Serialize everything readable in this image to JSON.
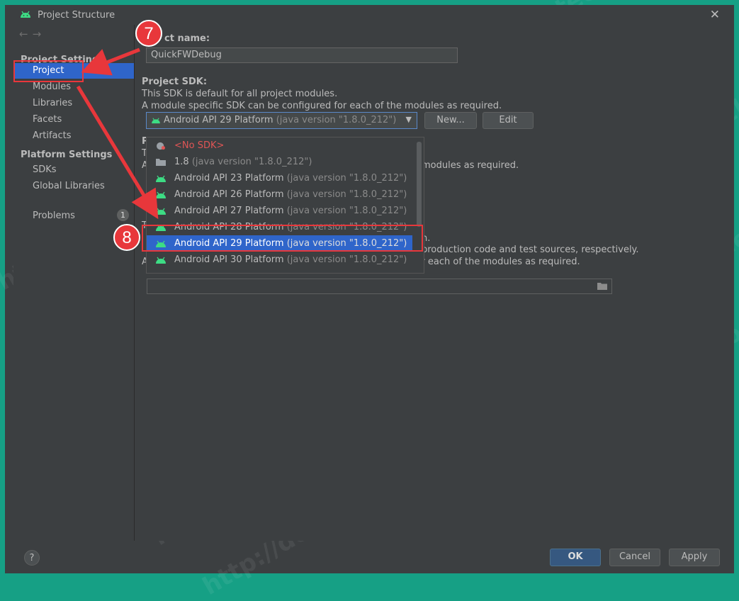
{
  "window": {
    "title": "Project Structure"
  },
  "sidebar": {
    "project_settings_header": "Project Settings",
    "items": [
      {
        "label": "Project"
      },
      {
        "label": "Modules"
      },
      {
        "label": "Libraries"
      },
      {
        "label": "Facets"
      },
      {
        "label": "Artifacts"
      }
    ],
    "platform_settings_header": "Platform Settings",
    "platform_items": [
      {
        "label": "SDKs"
      },
      {
        "label": "Global Libraries"
      }
    ],
    "problems": {
      "label": "Problems",
      "count": "1"
    }
  },
  "main": {
    "project_name_label": "ct name:",
    "project_name_value": "QuickFWDebug",
    "sdk_label": "Project SDK:",
    "sdk_desc1": "This SDK is default for all project modules.",
    "sdk_desc2": "A module specific SDK can be configured for each of the modules as required.",
    "sdk_combo_name": "Android API 29 Platform",
    "sdk_combo_version": "(java version \"1.8.0_212\")",
    "new_button": "New...",
    "edit_button": "Edit",
    "lang_label_frag": "P",
    "lang_text_frag": "T",
    "lang_text2_frag": "A",
    "lang_desc_tail": "modules as required.",
    "out_desc1_frag": "T",
    "out_desc1_tail": "h.",
    "out_desc2_tail": "production code and test sources, respectively.",
    "out_desc3": "A module specific compiler output path can be configured for each of the modules as required."
  },
  "dropdown": {
    "items": [
      {
        "name": "<No SDK>",
        "version": ""
      },
      {
        "name": "1.8",
        "version": "(java version \"1.8.0_212\")"
      },
      {
        "name": "Android API 23 Platform",
        "version": "(java version \"1.8.0_212\")"
      },
      {
        "name": "Android API 26 Platform",
        "version": "(java version \"1.8.0_212\")"
      },
      {
        "name": "Android API 27 Platform",
        "version": "(java version \"1.8.0_212\")"
      },
      {
        "name": "Android API 28 Platform",
        "version": "(java version \"1.8.0_212\")"
      },
      {
        "name": "Android API 29 Platform",
        "version": "(java version \"1.8.0_212\")"
      },
      {
        "name": "Android API 30 Platform",
        "version": "(java version \"1.8.0_212\")"
      }
    ],
    "selected": "Android API 29 Platform"
  },
  "footer": {
    "help": "?",
    "ok": "OK",
    "cancel": "Cancel",
    "apply": "Apply"
  },
  "annotations": {
    "step7": "7",
    "step8": "8",
    "color": "#e8373b"
  },
  "watermark": "http://dogee.tech",
  "colors": {
    "accent": "#2f65ca",
    "frame": "#16a085",
    "android_green": "#3ddc84"
  }
}
